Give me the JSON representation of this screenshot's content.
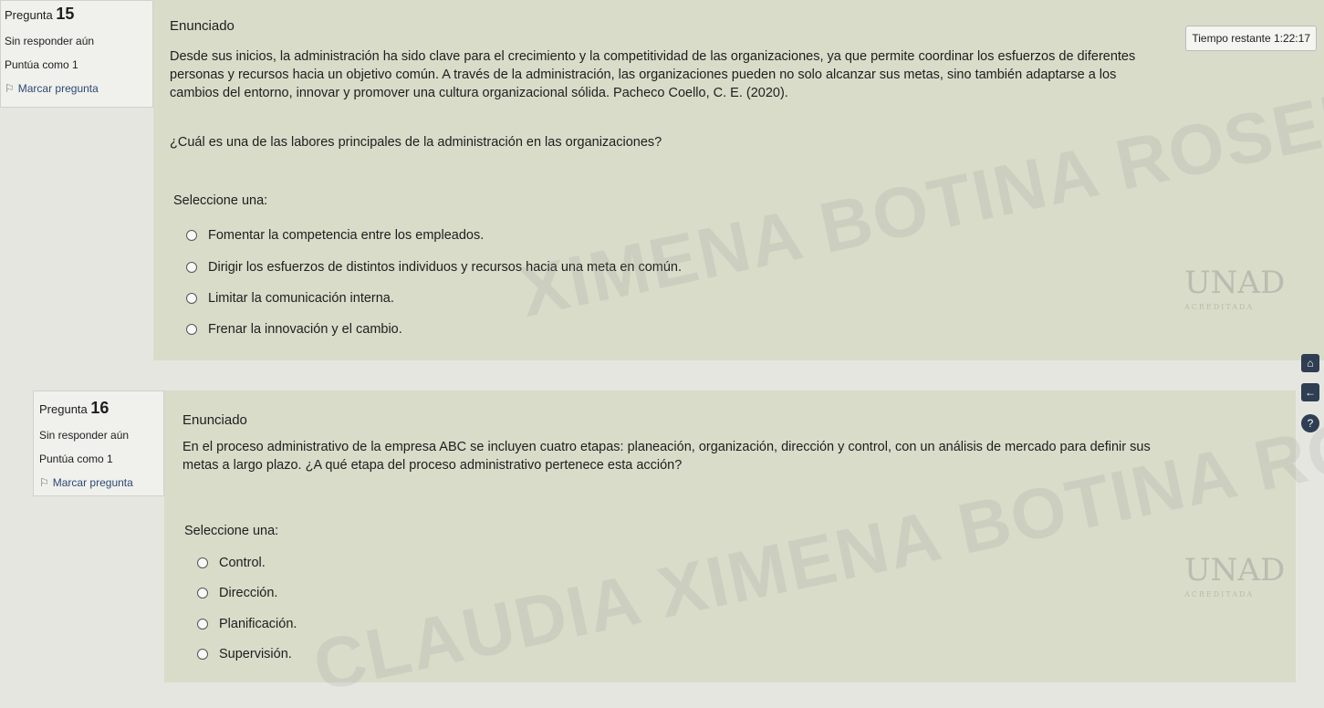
{
  "timer": {
    "label": "Tiempo restante 1:22:17"
  },
  "q15": {
    "pregunta_label": "Pregunta",
    "number": "15",
    "state": "Sin responder aún",
    "grade": "Puntúa como 1",
    "flag_label": "Marcar pregunta",
    "enunciado": "Enunciado",
    "text": "Desde sus inicios, la administración ha sido clave para el crecimiento y la competitividad de las organizaciones, ya que permite coordinar los esfuerzos de diferentes personas y recursos hacia un objetivo común. A través de la administración, las organizaciones pueden no solo alcanzar sus metas, sino también adaptarse a los cambios del entorno, innovar y promover una cultura organizacional sólida. Pacheco Coello, C. E. (2020).",
    "question": "¿Cuál es una de las labores principales de la administración en las organizaciones?",
    "select_label": "Seleccione una:",
    "options": [
      "Fomentar la competencia entre los empleados.",
      "Dirigir los esfuerzos de distintos individuos y recursos hacia una meta en común.",
      "Limitar la comunicación interna.",
      "Frenar la innovación y el cambio."
    ]
  },
  "q16": {
    "pregunta_label": "Pregunta",
    "number": "16",
    "state": "Sin responder aún",
    "grade": "Puntúa como 1",
    "flag_label": "Marcar pregunta",
    "enunciado": "Enunciado",
    "text": "En el proceso administrativo de la empresa ABC se incluyen cuatro etapas: planeación, organización, dirección y control, con un análisis de mercado para definir sus metas a largo plazo. ¿A qué etapa del proceso administrativo pertenece esta acción?",
    "select_label": "Seleccione una:",
    "options": [
      "Control.",
      "Dirección.",
      "Planificación.",
      "Supervisión."
    ]
  },
  "watermark": {
    "line1": "XIMENA BOTINA ROSERO",
    "line2": "CLAUDIA XIMENA BOTINA ROSERO"
  },
  "logo": {
    "text": "UNAD",
    "subtitle": "ACREDITADA"
  },
  "icons": {
    "flag": "flag-icon",
    "home": "home-icon",
    "back": "back-arrow-icon",
    "help": "help-icon"
  }
}
